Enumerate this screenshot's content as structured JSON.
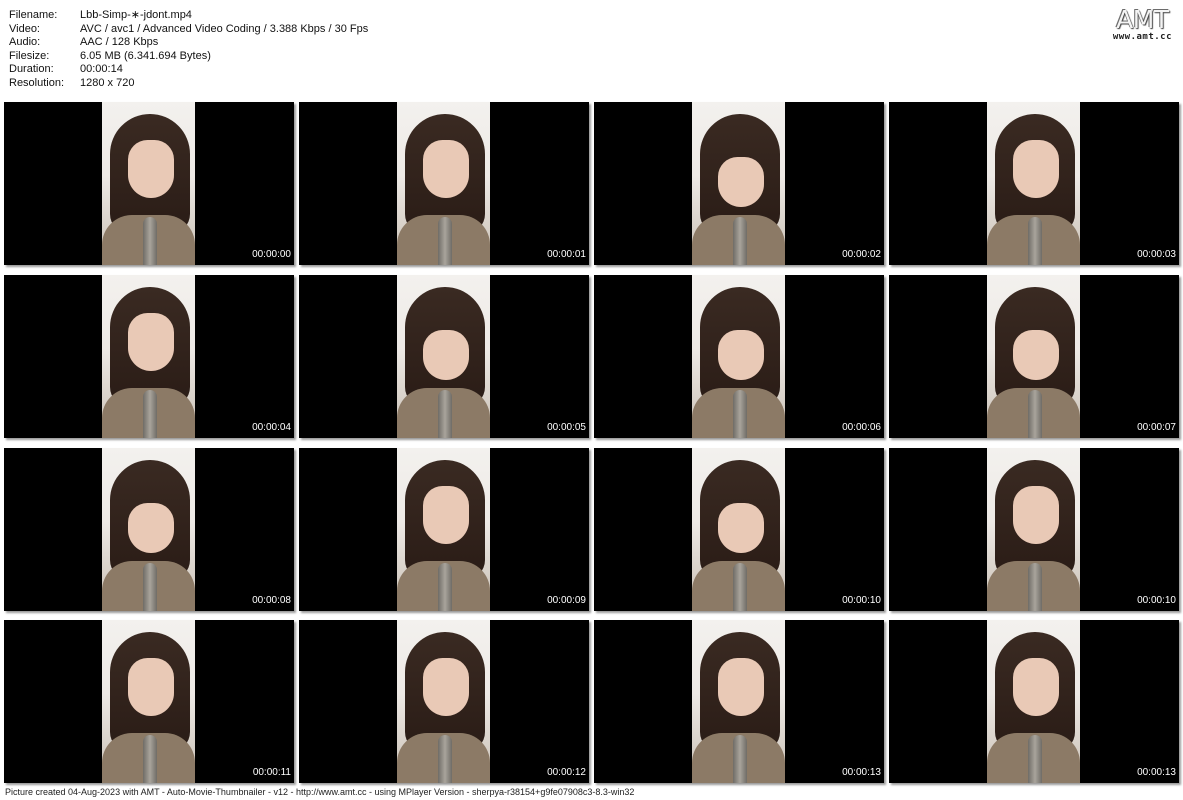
{
  "info": [
    {
      "key": "Filename:",
      "value": "Lbb-Simp-∗-jdont.mp4"
    },
    {
      "key": "Video:",
      "value": "AVC / avc1 / Advanced Video Coding / 3.388 Kbps / 30 Fps"
    },
    {
      "key": "Audio:",
      "value": "AAC / 128 Kbps"
    },
    {
      "key": "Filesize:",
      "value": "6.05 MB (6.341.694 Bytes)"
    },
    {
      "key": "Duration:",
      "value": "00:00:14"
    },
    {
      "key": "Resolution:",
      "value": "1280 x 720"
    }
  ],
  "logo": {
    "main": "AMT",
    "sub": "www.amt.cc"
  },
  "thumbnails": [
    {
      "time": "00:00:00",
      "pose": "up"
    },
    {
      "time": "00:00:01",
      "pose": "up"
    },
    {
      "time": "00:00:02",
      "pose": "down"
    },
    {
      "time": "00:00:03",
      "pose": "up"
    },
    {
      "time": "00:00:04",
      "pose": "up"
    },
    {
      "time": "00:00:05",
      "pose": "down"
    },
    {
      "time": "00:00:06",
      "pose": "down"
    },
    {
      "time": "00:00:07",
      "pose": "down"
    },
    {
      "time": "00:00:08",
      "pose": "down"
    },
    {
      "time": "00:00:09",
      "pose": "up"
    },
    {
      "time": "00:00:10",
      "pose": "down"
    },
    {
      "time": "00:00:10",
      "pose": "up"
    },
    {
      "time": "00:00:11",
      "pose": "up"
    },
    {
      "time": "00:00:12",
      "pose": "up"
    },
    {
      "time": "00:00:13",
      "pose": "up"
    },
    {
      "time": "00:00:13",
      "pose": "up"
    }
  ],
  "footer": "Picture created 04-Aug-2023 with AMT - Auto-Movie-Thumbnailer - v12 - http://www.amt.cc - using MPlayer Version - sherpya-r38154+g9fe07908c3-8.3-win32"
}
